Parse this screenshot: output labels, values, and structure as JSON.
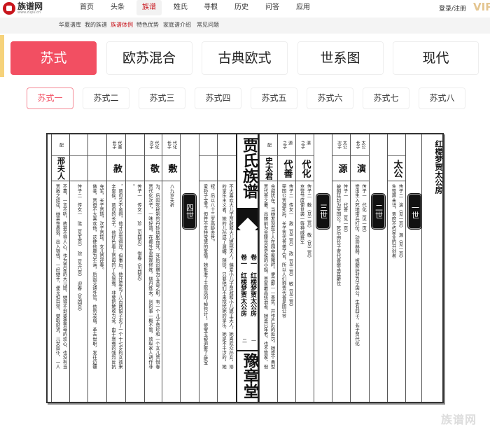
{
  "header": {
    "logo_name": "族谱网",
    "logo_url": "www.zupu.cn",
    "nav": [
      "首页",
      "头条",
      "族谱",
      "姓氏",
      "寻根",
      "历史",
      "问答",
      "应用"
    ],
    "nav_active": 2,
    "login": "登录/注册",
    "vip": "VIP"
  },
  "subnav": {
    "items": [
      "华夏谱库",
      "我的族谱",
      "族谱体例",
      "特色优势",
      "家庭谱介绍",
      "常见问题"
    ],
    "active": 2
  },
  "style_tabs": {
    "items": [
      "苏式",
      "欧苏混合",
      "古典欧式",
      "世系图",
      "现代"
    ],
    "active": 0
  },
  "sub_tabs": {
    "items": [
      "苏式一",
      "苏式二",
      "苏式三",
      "苏式四",
      "苏式五",
      "苏式六",
      "苏式七",
      "苏式八"
    ],
    "active": 0
  },
  "colors": {
    "accent": "#f24f62",
    "brand": "#c8161d"
  },
  "document": {
    "title_col": "红楼梦贾太公房",
    "center": {
      "title": "贾氏族谱",
      "volumes": [
        {
          "vol": "卷一",
          "name": "红楼梦贾太公房",
          "page": "一"
        },
        {
          "vol": "卷一",
          "name": "红楼梦贾太公房",
          "page": "二"
        }
      ],
      "hall": "豫章堂"
    },
    "columns": [
      {
        "type": "gen",
        "label": "一世"
      },
      {
        "type": "person",
        "header": "",
        "name": "太公",
        "lines": [
          "生殁葬未详，贾府不朽家业的开创者",
          "传子二　演（见一页）　源（见一页）"
        ]
      },
      {
        "type": "gen",
        "label": "二世"
      },
      {
        "type": "person",
        "header": "太公\n长子",
        "name": "演",
        "lines": [
          "誉出生入死地带兵打仗，功勋赫赫，被朝廷封为宁国公，生有四子，长子贾代化",
          "传子一　代化（见一页）"
        ]
      },
      {
        "type": "person",
        "header": "太公\n次子",
        "name": "源",
        "lines": [
          "被朝廷封为荣国公，死后由长子贾代善继承其爵位",
          "传子一　代善（见一页）"
        ]
      },
      {
        "type": "gen",
        "label": "三世"
      },
      {
        "type": "person",
        "header": "演\n之子",
        "name": "代化",
        "lines": [
          "京营节度使世袭一等神威将军",
          "传子二　敷（见二页）　敬（见二页）"
        ]
      },
      {
        "type": "person",
        "header": "源\n之子",
        "name": "代善",
        "lines": [
          "荣国公贾源死后，长子贾代善袭了官，所以人们称贾代善是国公爷",
          "传子二　传女一　赦（见二页）　政（见三页）　敏（见三页）"
        ]
      },
      {
        "type": "person",
        "header": "配",
        "name": "史太君",
        "lines": [
          "贾代善之妻，出嫁前为金陵世家史侯的小姐，贾家最高统治者，她虽已年老，也不管家，但",
          "余威犹在，当她发现有下人在园中聚赌时，便立即一一查实，并作严厉的处罚，她是个典型"
        ]
      },
      {
        "type": "center"
      },
      {
        "type": "person",
        "header": "",
        "name": "",
        "lines": [
          "的享乐主义者，她的儿孙成了渥樾，随徒，只要他们不来搅扰她的享乐，她是不干涉的，她",
          "不大喜欢大儿子贾赦和大儿媳邢夫人，偏爱小儿子贾政和小儿媳王夫人，她喜欢众孙女，溺"
        ]
      },
      {
        "type": "person",
        "header": "",
        "name": "",
        "lines": [
          "爱孙子宝玉，但并不支持宝黛的爱情，她批准了王熙凤的“掉包计”，使宝玉被迫娶了薛宝",
          "钗，后以八十三岁高龄去世。"
        ]
      },
      {
        "type": "gen",
        "label": "四世"
      },
      {
        "type": "person",
        "header": "代化\n长子",
        "name": "敷",
        "lines": [
          "八九岁夭折"
        ]
      },
      {
        "type": "person",
        "header": "代化\n次子",
        "name": "敬",
        "lines": [
          "贾代化次子，一味好道，在都外玄真观修炼，烧丹炼汞，别的事一概不管，放纵家人胡作非",
          "为，后因吃秘制的丹砂烧胀而死，死后追赠为五品之职，有一个儿子贾珍和一个女儿贾惜春"
        ]
      },
      {
        "type": "person",
        "header": "",
        "name": "",
        "lines": [
          "。",
          "传子一　传女一　珍（见四页）　惜春（见四页）"
        ]
      },
      {
        "type": "person",
        "header": "代善\n长子",
        "name": "赦",
        "lines": [
          "字恩侯，贾母的长子，他好色看上贾母的丫头鸳鸯，非要把她收为妾，由于鸳鸯的强烈反抗",
          "，贾母又不舍得，他才没有得逞，但事后，他还是花了八百两银子买了一个十七岁的女孩来"
        ]
      },
      {
        "type": "person",
        "header": "",
        "name": "",
        "lines": [
          "做妾，贾母不大喜欢他，这使他颇为不满，后因交通外官，依势凌弱，革去世职，发往边疆",
          "充军，长子贾琏，次子贾琮，女儿贾迎春。"
        ]
      },
      {
        "type": "person",
        "header": "",
        "name": "",
        "lines": [
          "传子二　传女一　琏（见五页）　琮（见六页）　迎春（见四页）"
        ]
      },
      {
        "type": "person",
        "header": "配",
        "name": "邢夫人",
        "lines": [
          "贾赦之续弦，她禀性愚弱，出入银钱，一经她手，便克扣异常，婪取财货，儿女奴仆，一人",
          "不靠，一言不听，故甚不得人心，作为贾家的大儿媳，她得不到婆婆贾母的欢心，也没有当"
        ]
      }
    ]
  },
  "watermark": "族谱网"
}
